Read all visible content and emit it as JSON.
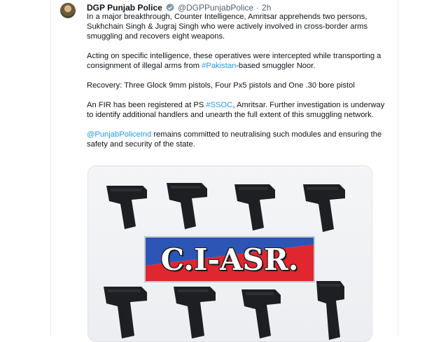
{
  "tweet": {
    "author_name": "DGP Punjab Police",
    "handle": "@DGPPunjabPolice",
    "separator": "·",
    "time": "2h",
    "paragraphs": [
      {
        "text": "In a major breakthrough, Counter Intelligence, Amritsar apprehends two persons, Sukhchain Singh & Jugraj Singh who were actively involved in cross-border arms smuggling and recovers eight weapons."
      },
      {
        "pre": "Acting on specific intelligence, these operatives were intercepted while transporting a consignment of illegal arms from ",
        "link": "#Pakistan",
        "post": "-based smuggler Noor."
      },
      {
        "text": "Recovery: Three Glock 9mm pistols, Four Px5 pistols and One .30 bore pistol"
      },
      {
        "pre": "An FIR has been registered at PS ",
        "link": "#SSOC",
        "post": ", Amritsar. Further investigation is underway to identify additional handlers and unearth the full extent of this smuggling network."
      },
      {
        "pre": "",
        "link": "@PunjabPoliceInd",
        "post": " remains committed to neutralising such modules and ensuring the safety and security of the state."
      }
    ],
    "media": {
      "banner_text": "C.I-ASR.",
      "banner_colors": {
        "top": "#2d55b5",
        "bottom": "#e0262e"
      },
      "weapon_count": 8
    }
  },
  "colors": {
    "link": "#1d9bf0",
    "verified": "#829aab",
    "text": "#0f1419",
    "muted": "#536471"
  }
}
